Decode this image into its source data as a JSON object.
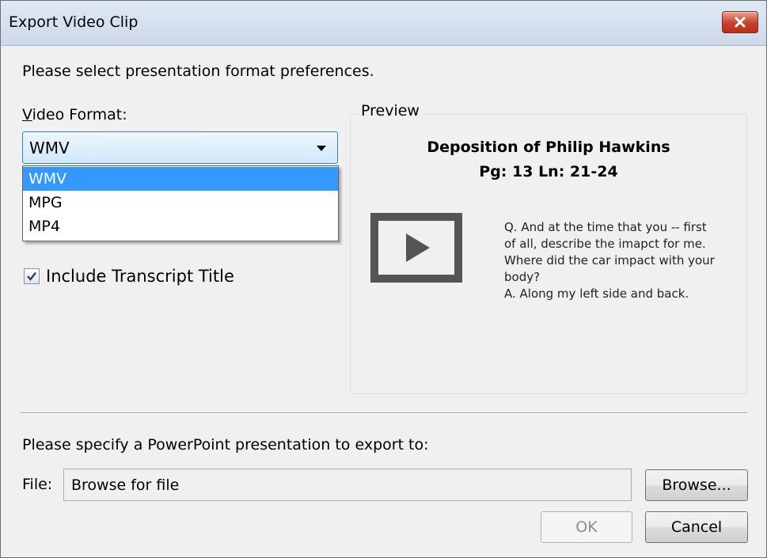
{
  "window": {
    "title": "Export Video Clip"
  },
  "intro": "Please select presentation format preferences.",
  "video_format": {
    "label_accel": "V",
    "label_rest": "ideo Format:",
    "selected": "WMV",
    "options": [
      "WMV",
      "MPG",
      "MP4"
    ]
  },
  "include_title": {
    "label": "Include Transcript Title",
    "checked": true
  },
  "preview": {
    "legend": "Preview",
    "title_line1": "Deposition of Philip Hawkins",
    "title_line2": "Pg: 13 Ln: 21-24",
    "text_lines": [
      "Q.  And at the time that you -- first",
      "of all, describe the imapct for me.",
      "Where did the car impact with your",
      "body?",
      "A.   Along my left side and back."
    ]
  },
  "export": {
    "prompt": "Please specify a PowerPoint presentation to export to:",
    "file_label": "File:",
    "file_value": "Browse for file",
    "browse_label": "Browse...",
    "ok_label": "OK",
    "cancel_label": "Cancel"
  },
  "colors": {
    "selection": "#3399ff",
    "close_button": "#c7402a"
  },
  "icons": [
    "close-icon",
    "chevron-down-icon",
    "checkmark-icon",
    "play-icon"
  ]
}
